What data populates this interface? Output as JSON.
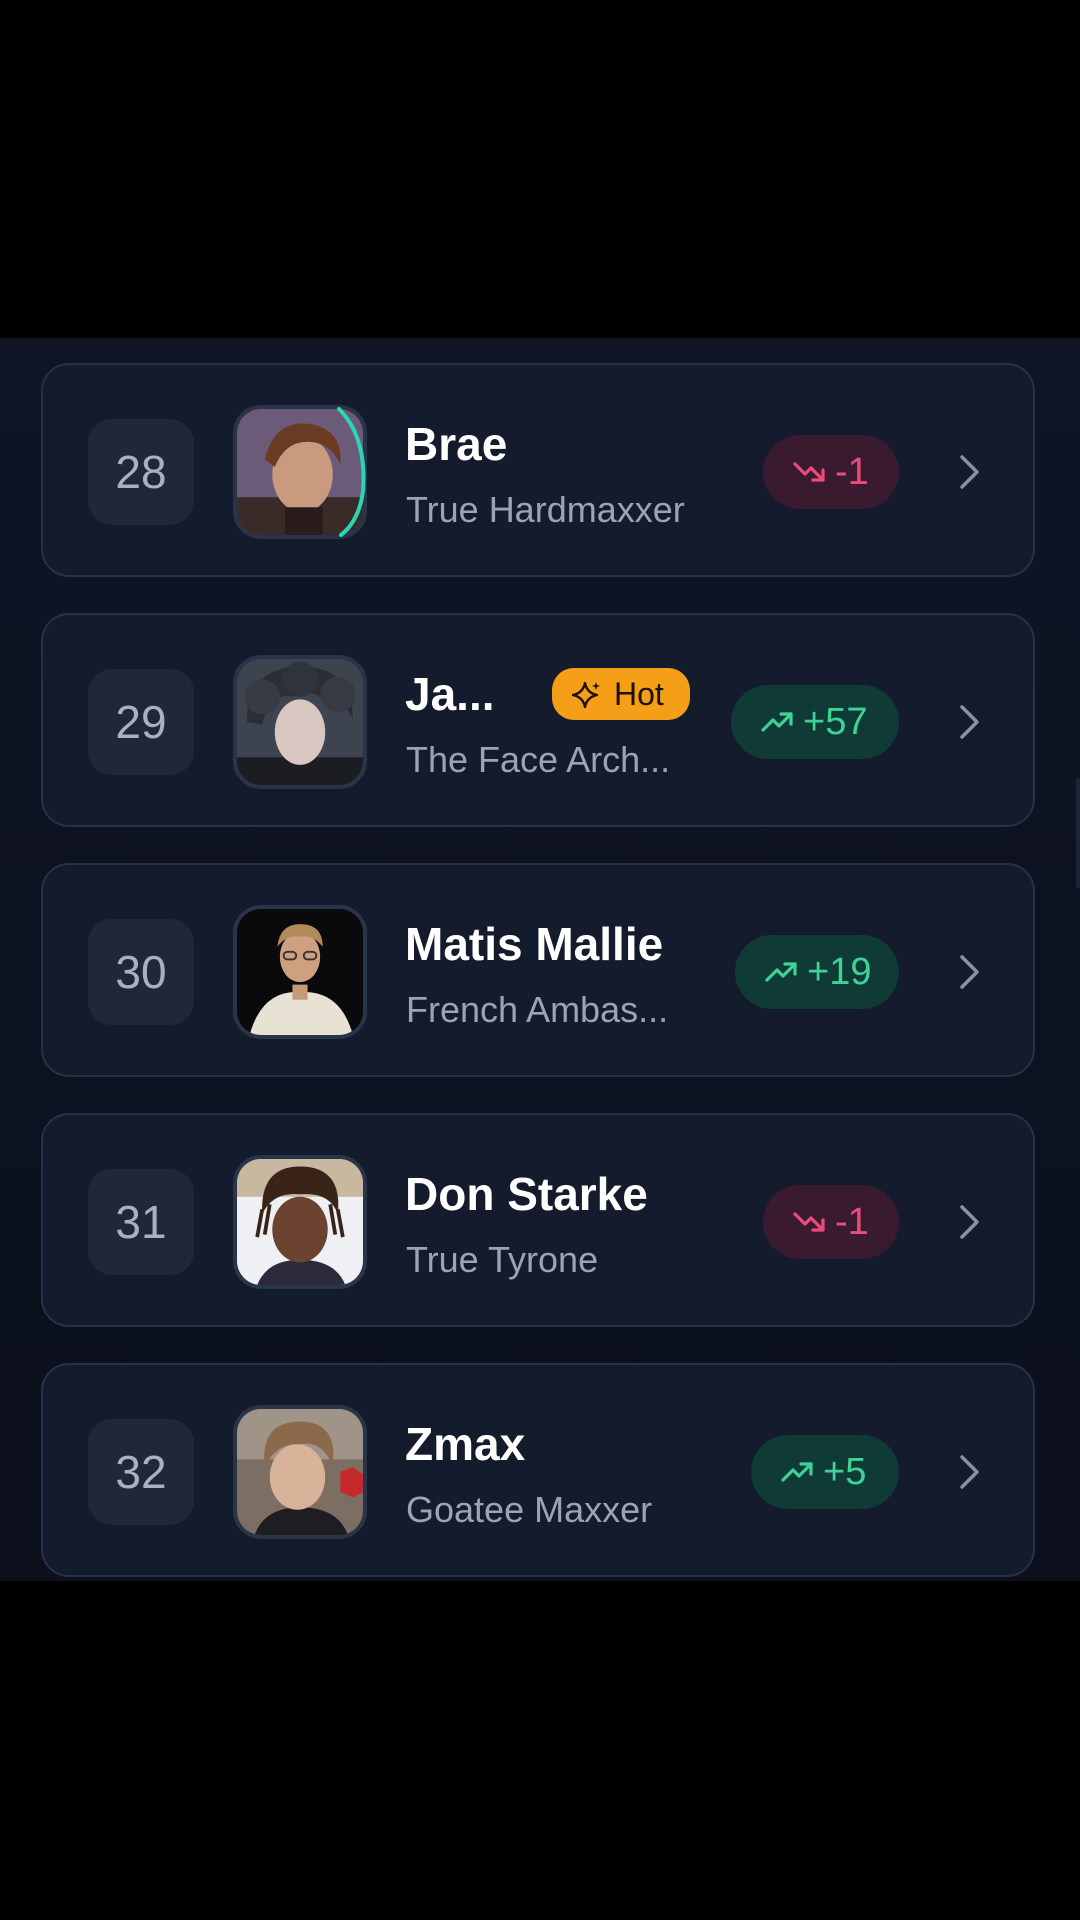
{
  "colors": {
    "background": "#0d1220",
    "card": "#141b2c",
    "trend_down": "#ec4c7c",
    "trend_up": "#3ed395",
    "hot": "#f59e18"
  },
  "leaderboard": [
    {
      "rank": "28",
      "name": "Brae",
      "subtitle": "True Hardmaxxer",
      "trend": "-1",
      "direction": "down",
      "hot": false
    },
    {
      "rank": "29",
      "name": "Ja...",
      "subtitle": "The Face Arch...",
      "trend": "+57",
      "direction": "up",
      "hot": true,
      "hot_label": "Hot"
    },
    {
      "rank": "30",
      "name": "Matis Mallie",
      "subtitle": "French Ambas...",
      "trend": "+19",
      "direction": "up",
      "hot": false
    },
    {
      "rank": "31",
      "name": "Don Starke",
      "subtitle": "True Tyrone",
      "trend": "-1",
      "direction": "down",
      "hot": false
    },
    {
      "rank": "32",
      "name": "Zmax",
      "subtitle": "Goatee Maxxer",
      "trend": "+5",
      "direction": "up",
      "hot": false
    }
  ]
}
